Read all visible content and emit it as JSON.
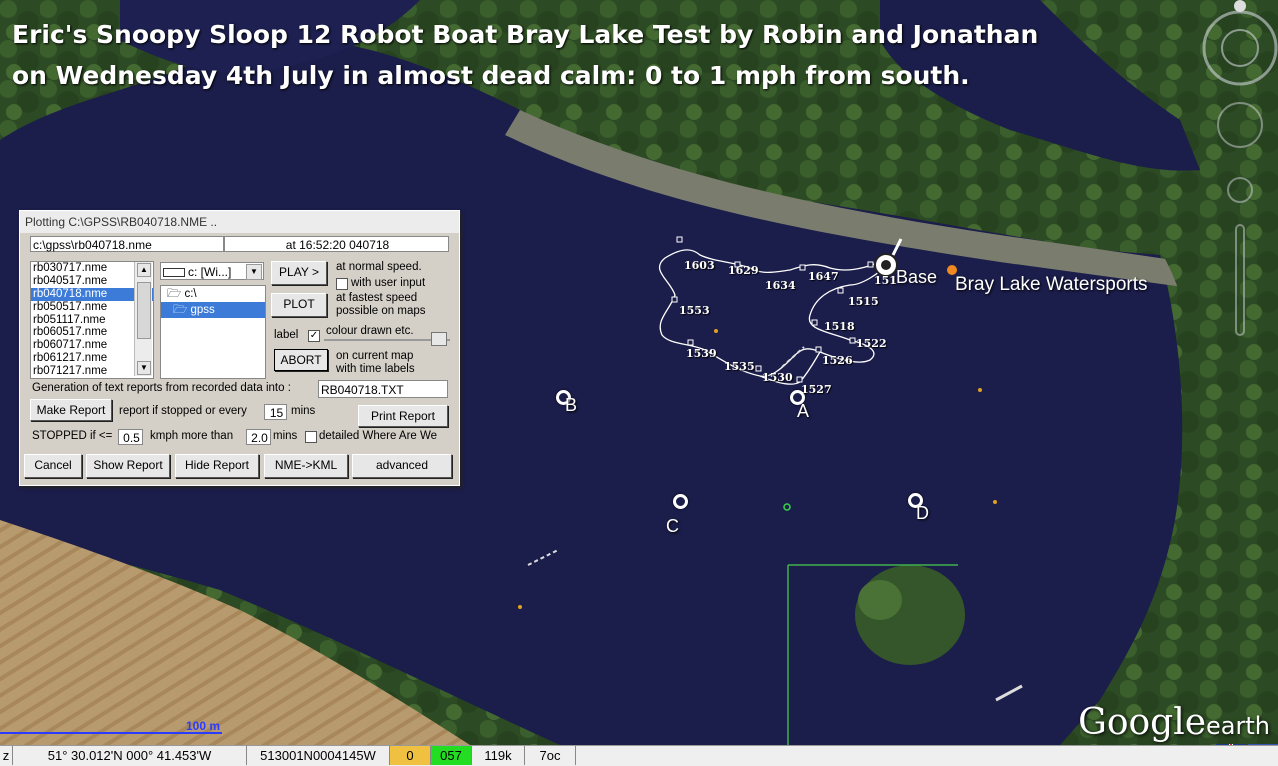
{
  "title_line1": "Eric's Snoopy Sloop 12 Robot Boat Bray Lake Test by Robin and Jonathan",
  "title_line2": "on Wednesday 4th July in almost dead calm: 0 to 1 mph from south.",
  "map": {
    "place_label": "Bray Lake Watersports",
    "base_label": "Base",
    "markers": [
      "A",
      "B",
      "C",
      "D"
    ],
    "time_labels": [
      "1603",
      "1629",
      "1634",
      "1647",
      "1515",
      "1553",
      "1518",
      "1522",
      "1539",
      "1535",
      "1530",
      "1527",
      "1526",
      "151"
    ],
    "scale_label": "100 m",
    "logo_text": "Google",
    "logo_suffix": "earth"
  },
  "dialog": {
    "title": "Plotting C:\\GPSS\\RB040718.NME ..",
    "path": "c:\\gpss\\rb040718.nme",
    "timestamp": "at 16:52:20 040718",
    "files": [
      "rb030717.nme",
      "rb040517.nme",
      "rb040718.nme",
      "rb050517.nme",
      "rb051117.nme",
      "rb060517.nme",
      "rb060717.nme",
      "rb061217.nme",
      "rb071217.nme"
    ],
    "selected_file": "rb040718.nme",
    "drive": "c: [Wi...]",
    "folders": [
      "c:\\",
      "gpss"
    ],
    "play_label": "PLAY >",
    "plot_label": "PLOT",
    "abort_label": "ABORT",
    "normal_speed": "at normal speed.",
    "with_user_input": "with user input",
    "fastest_speed": "at fastest speed",
    "possible_on_maps": "possible on maps",
    "label_text": "label",
    "colour_drawn": "colour drawn etc.",
    "current_map": "on current map",
    "time_labels": "with time labels",
    "generation_text": "Generation of text reports from recorded data into :",
    "report_file": "RB040718.TXT",
    "make_report": "Make Report",
    "report_if_stopped": "report if stopped or every",
    "every_mins_value": "15",
    "mins": "mins",
    "print_report": "Print Report",
    "stopped_if": "STOPPED if <=",
    "stopped_kmph": "0.5",
    "kmph_more_than": "kmph more than",
    "more_than_value": "2.0",
    "mins2": "mins",
    "detailed": "detailed Where Are We",
    "cancel": "Cancel",
    "show_report": "Show Report",
    "hide_report": "Hide Report",
    "nme_kml": "NME->KML",
    "advanced": "advanced"
  },
  "status": {
    "z": "z",
    "latlon": "51° 30.012'N 000° 41.453'W",
    "code": "513001N0004145W",
    "v1": "0",
    "v2": "057",
    "v3": "119k",
    "v4": "7oc"
  },
  "colors": {
    "water": "#1b1d4a",
    "land": "#2e4a22",
    "track": "#ffffff",
    "status_green": "#22dd22",
    "status_yellow": "#f0c040"
  }
}
